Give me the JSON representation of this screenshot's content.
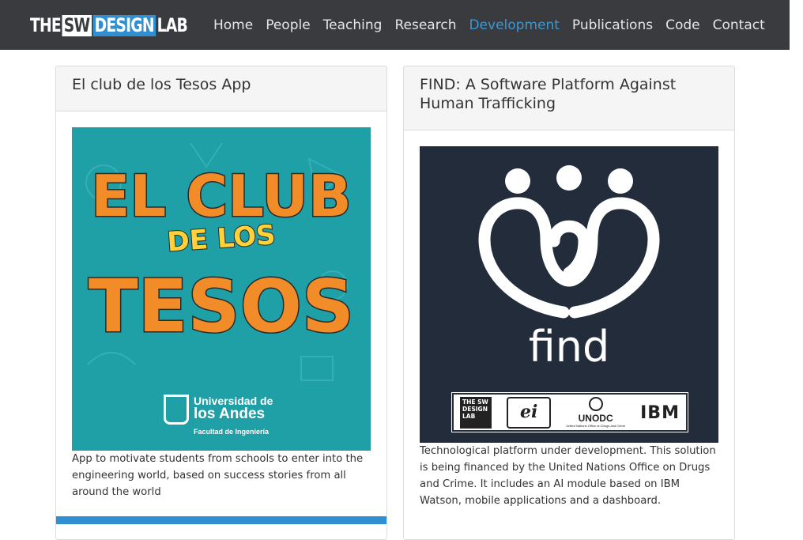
{
  "navbar": {
    "logo": {
      "part1": "THE",
      "part2": "SW",
      "part3": "DESIGN",
      "part4": "LAB"
    },
    "links": [
      "Home",
      "People",
      "Teaching",
      "Research",
      "Development",
      "Publications",
      "Code",
      "Contact"
    ],
    "active": "Development",
    "accent_color": "#3a98d4"
  },
  "cards": [
    {
      "title": "El club de los Tesos App",
      "image": {
        "line1": "EL CLUB",
        "line2": "DE LOS",
        "line3": "TESOS",
        "institution_1": "Universidad de",
        "institution_2": "los Andes",
        "institution_3": "Facultad de Ingeniería"
      },
      "description": "App to motivate students from schools to enter into the engineering world, based on success stories from all around the world"
    },
    {
      "title": "FIND: A Software Platform Against Human Trafficking",
      "image": {
        "word": "find",
        "partners": [
          "THE SW DESIGN LAB",
          "ei",
          "UNODC",
          "IBM"
        ],
        "unodc_sub": "United Nations Office on Drugs and Crime"
      },
      "description": "Technological platform under development. This solution is being financed by the United Nations Office on Drugs and Crime. It includes an AI module based on IBM Watson, mobile applications and a dashboard."
    }
  ]
}
